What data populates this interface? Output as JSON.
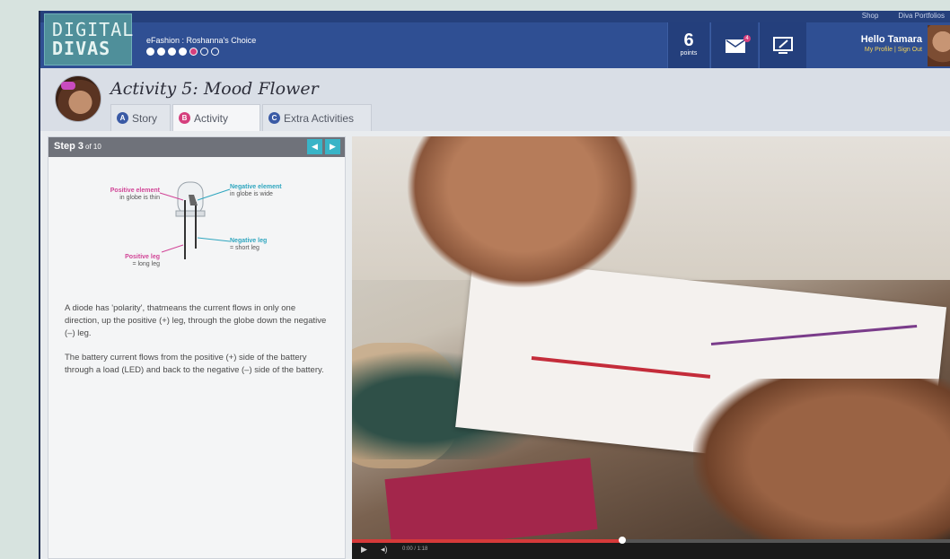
{
  "header": {
    "logo_line1": "DIGITAL",
    "logo_line2": "DIVAS",
    "top_links": [
      "Shop",
      "Diva Portfolios"
    ],
    "course_title": "eFashion : Roshanna's Choice",
    "progress": {
      "total": 7,
      "completed": 4,
      "current": 5
    },
    "points_value": "6",
    "points_label": "points",
    "mail_badge": "4",
    "greeting": "Hello Tamara",
    "profile_link": "My Profile",
    "signout_link": "Sign Out"
  },
  "activity": {
    "title": "Activity 5: Mood Flower",
    "tabs": [
      {
        "letter": "A",
        "label": "Story",
        "color": "#3a5aa5"
      },
      {
        "letter": "B",
        "label": "Activity",
        "color": "#d53f7d",
        "active": true
      },
      {
        "letter": "C",
        "label": "Extra Activities",
        "color": "#3a5aa5"
      }
    ]
  },
  "step": {
    "label": "Step 3",
    "of": "of 10",
    "prev_icon": "chevron-left-icon",
    "next_icon": "chevron-right-icon",
    "diagram": {
      "positive_element": "Positive element",
      "positive_element_sub": "in globe is thin",
      "negative_element": "Negative element",
      "negative_element_sub": "in globe is wide",
      "positive_leg": "Positive leg",
      "positive_leg_sub": "= long leg",
      "negative_leg": "Negative leg",
      "negative_leg_sub": "= short leg"
    },
    "paragraphs": [
      "A diode has 'polarity', thatmeans the current flows in only one direction, up the positive (+) leg, through the globe down the negative (–) leg.",
      "The battery current flows from the positive (+) side of the battery through a load (LED) and back to the negative (–) side of the battery."
    ]
  },
  "video": {
    "progress": 0.45,
    "time": "0:00 / 1:18"
  },
  "colors": {
    "header_blue": "#2f4f93",
    "accent_pink": "#d53f7d",
    "accent_teal": "#39b4c7"
  }
}
